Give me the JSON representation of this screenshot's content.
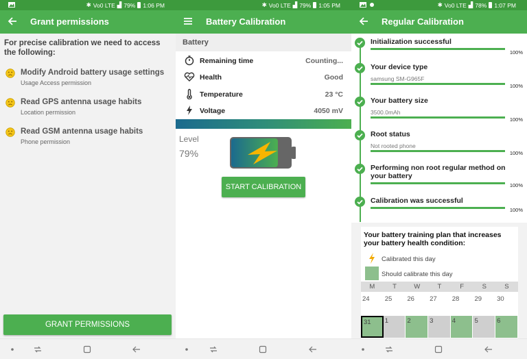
{
  "colors": {
    "accent": "#4caf50",
    "statusbar": "#3d9a3d",
    "should_calibrate": "#8dbf8d"
  },
  "screen1": {
    "status": {
      "network": "Vo0 LTE",
      "battery": "79%",
      "time": "1:06 PM"
    },
    "toolbar": {
      "title": "Grant permissions",
      "back_icon": "arrow-back-icon"
    },
    "intro": "For precise calibration we need to access the following:",
    "permissions": [
      {
        "title": "Modify Android battery usage settings",
        "subtitle": "Usage Access permission",
        "icon": "sad-face-icon"
      },
      {
        "title": "Read GPS antenna usage habits",
        "subtitle": "Location permission",
        "icon": "sad-face-icon"
      },
      {
        "title": "Read GSM antenna usage habits",
        "subtitle": "Phone permission",
        "icon": "sad-face-icon"
      }
    ],
    "grant_button": "GRANT PERMISSIONS"
  },
  "screen2": {
    "status": {
      "network": "Vo0 LTE",
      "battery": "79%",
      "time": "1:05 PM"
    },
    "toolbar": {
      "title": "Battery Calibration",
      "menu_icon": "hamburger-menu-icon"
    },
    "section": "Battery",
    "rows": [
      {
        "label": "Remaining time",
        "value": "Counting...",
        "icon": "stopwatch-icon"
      },
      {
        "label": "Health",
        "value": "Good",
        "icon": "heart-pulse-icon"
      },
      {
        "label": "Temperature",
        "value": "23 °C",
        "icon": "thermometer-icon"
      },
      {
        "label": "Voltage",
        "value": "4050 mV",
        "icon": "lightning-icon"
      }
    ],
    "level_label": "Level",
    "level_value": "79%",
    "level_fraction": 0.79,
    "start_button": "START CALIBRATION"
  },
  "screen3": {
    "status": {
      "network": "Vo0 LTE",
      "battery": "78%",
      "time": "1:07 PM"
    },
    "toolbar": {
      "title": "Regular Calibration",
      "back_icon": "arrow-back-icon"
    },
    "steps": [
      {
        "title": "Initialization successful",
        "subtitle": "",
        "percent": "100%"
      },
      {
        "title": "Your device type",
        "subtitle": "samsung SM-G965F",
        "percent": "100%"
      },
      {
        "title": "Your battery size",
        "subtitle": "3500.0mAh",
        "percent": "100%"
      },
      {
        "title": "Root status",
        "subtitle": "Not rooted phone",
        "percent": "100%"
      },
      {
        "title": "Performing non root regular method on your battery",
        "subtitle": "",
        "percent": "100%"
      },
      {
        "title": "Calibration was successful",
        "subtitle": "",
        "percent": "100%"
      }
    ],
    "plan": {
      "title": "Your battery training plan that increases your battery health condition:",
      "legend_calibrated": "Calibrated this day",
      "legend_should": "Should calibrate this day",
      "weekdays": [
        "M",
        "T",
        "W",
        "T",
        "F",
        "S",
        "S"
      ],
      "week1": [
        "24",
        "25",
        "26",
        "27",
        "28",
        "29",
        "30"
      ],
      "week2": [
        {
          "day": "31",
          "state": "should-today"
        },
        {
          "day": "1",
          "state": "none"
        },
        {
          "day": "2",
          "state": "should"
        },
        {
          "day": "3",
          "state": "none"
        },
        {
          "day": "4",
          "state": "should"
        },
        {
          "day": "5",
          "state": "none"
        },
        {
          "day": "6",
          "state": "should"
        }
      ]
    }
  }
}
